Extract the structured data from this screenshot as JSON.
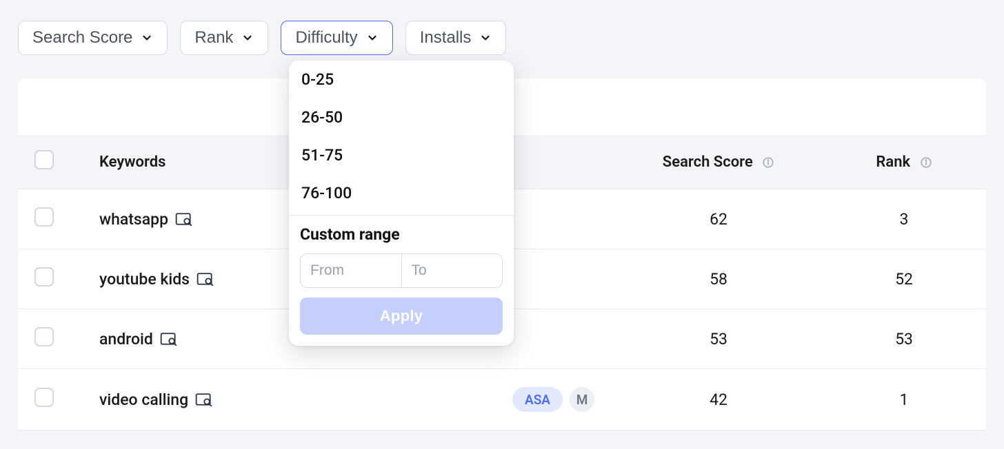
{
  "filters": [
    {
      "label": "Search Score",
      "active": false
    },
    {
      "label": "Rank",
      "active": false
    },
    {
      "label": "Difficulty",
      "active": true
    },
    {
      "label": "Installs",
      "active": false
    }
  ],
  "dropdown": {
    "options": [
      "0-25",
      "26-50",
      "51-75",
      "76-100"
    ],
    "custom_label": "Custom range",
    "from_placeholder": "From",
    "to_placeholder": "To",
    "apply_label": "Apply"
  },
  "columns": {
    "keywords": "Keywords",
    "search_score": "Search Score",
    "rank": "Rank"
  },
  "rows": [
    {
      "keyword": "whatsapp",
      "tags": [],
      "search_score": "62",
      "rank": "3"
    },
    {
      "keyword": "youtube kids",
      "tags": [],
      "search_score": "58",
      "rank": "52"
    },
    {
      "keyword": "android",
      "tags": [],
      "search_score": "53",
      "rank": "53"
    },
    {
      "keyword": "video calling",
      "tags": [
        "ASA",
        "M"
      ],
      "search_score": "42",
      "rank": "1"
    }
  ]
}
